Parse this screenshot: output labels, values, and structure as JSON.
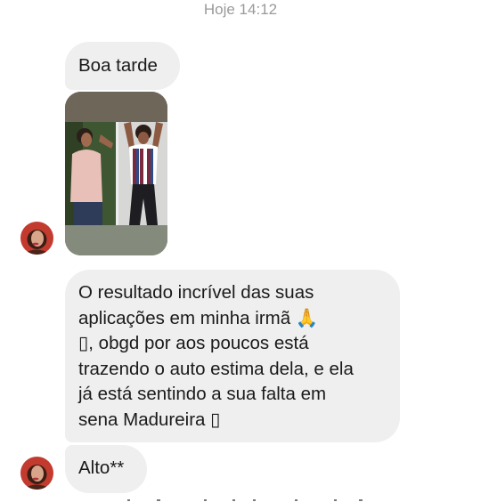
{
  "chat": {
    "timestamp": "Hoje 14:12",
    "messages": [
      {
        "type": "text",
        "text": "Boa tarde"
      },
      {
        "type": "image",
        "content": "photo of two women side by side"
      },
      {
        "type": "text",
        "lines": [
          "O resultado incrível das suas",
          "aplicações em minha irmã 🙏",
          "▯, obgd por aos poucos está",
          "trazendo o auto estima dela, e ela",
          "já está sentindo a sua falta em",
          "sena Madureira ▯"
        ]
      },
      {
        "type": "text",
        "text": "Alto**"
      }
    ]
  },
  "colors": {
    "bubble_bg": "#efefef",
    "text": "#1a1a1a",
    "timestamp": "#9a9a9a",
    "background": "#ffffff"
  },
  "icons": {
    "emoji": "folded-hands-emoji",
    "avatar": "contact-avatar"
  }
}
